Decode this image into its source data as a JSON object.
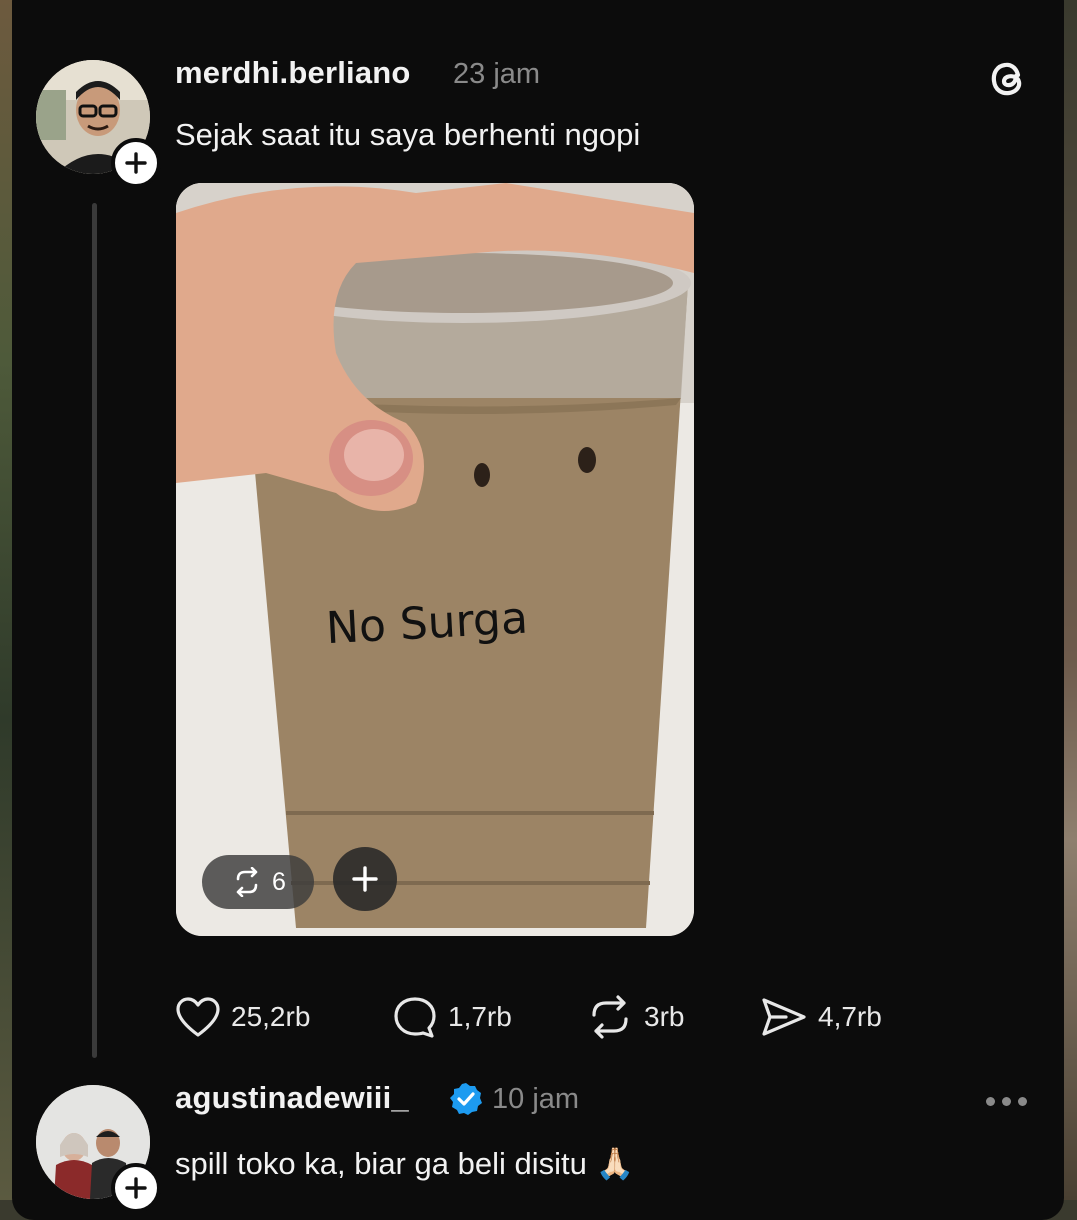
{
  "post": {
    "username": "merdhi.berliano",
    "time": "23 jam",
    "text": "Sejak saat itu saya berhenti ngopi",
    "image_caption_handwritten": "No Surga",
    "media_repost_count": "6",
    "actions": {
      "likes": "25,2rb",
      "replies": "1,7rb",
      "reposts": "3rb",
      "shares": "4,7rb"
    }
  },
  "reply": {
    "username": "agustinadewiii_",
    "time": "10 jam",
    "text": "spill toko ka, biar ga beli disitu",
    "emoji": "🙏🏻"
  },
  "colors": {
    "background": "#0c0c0c",
    "text_primary": "#f2f2f2",
    "text_secondary": "#8a8a8a",
    "verified_blue": "#1d9bf0"
  }
}
